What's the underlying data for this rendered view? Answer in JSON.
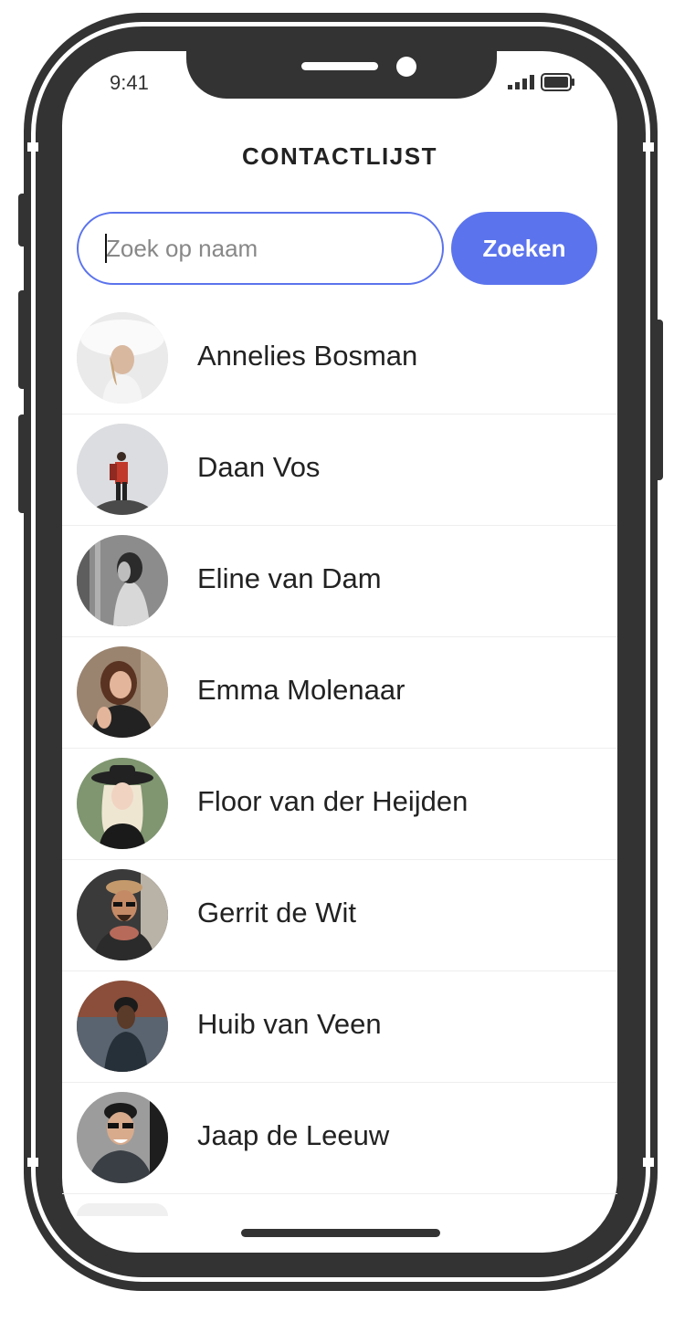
{
  "status_bar": {
    "time": "9:41",
    "signal_icon": "cellular-signal-icon",
    "battery_icon": "battery-icon"
  },
  "header": {
    "title": "CONTACTLIJST"
  },
  "search": {
    "placeholder": "Zoek op naam",
    "value": "",
    "button_label": "Zoeken"
  },
  "colors": {
    "accent": "#5b73ec",
    "frame": "#333333",
    "text": "#222222"
  },
  "contacts": [
    {
      "name": "Annelies Bosman"
    },
    {
      "name": "Daan Vos"
    },
    {
      "name": "Eline van Dam"
    },
    {
      "name": "Emma Molenaar"
    },
    {
      "name": "Floor van der Heijden"
    },
    {
      "name": "Gerrit de Wit"
    },
    {
      "name": "Huib van Veen"
    },
    {
      "name": "Jaap de Leeuw"
    }
  ]
}
